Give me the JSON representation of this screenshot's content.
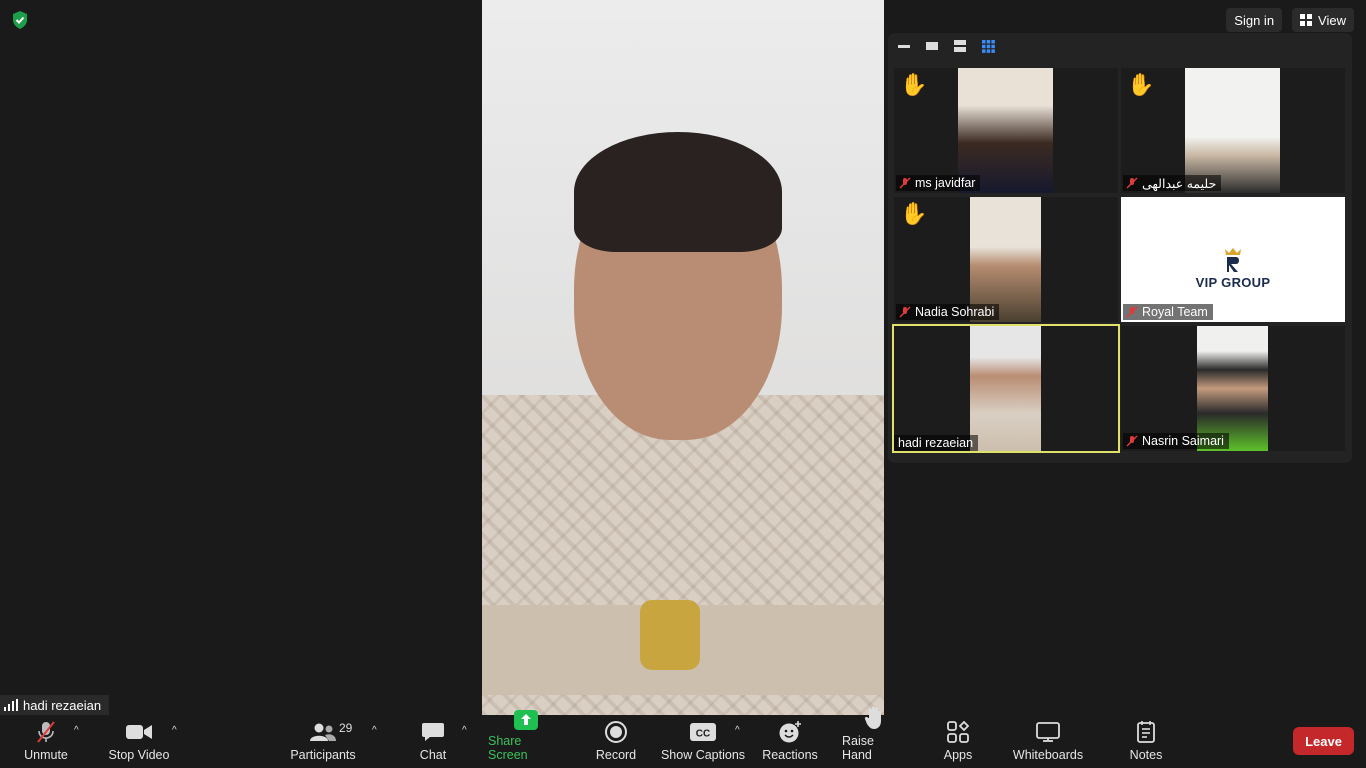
{
  "top": {
    "sign_in": "Sign in",
    "view": "View"
  },
  "main_speaker": {
    "name": "hadi rezaeian"
  },
  "gallery": {
    "tiles": [
      {
        "name": "ms javidfar",
        "muted": true,
        "hand_raised": true
      },
      {
        "name": "حلیمه عبدالهی",
        "muted": true,
        "hand_raised": true
      },
      {
        "name": "Nadia Sohrabi",
        "muted": true,
        "hand_raised": true
      },
      {
        "name": "Royal Team",
        "muted": true,
        "hand_raised": false,
        "logo_text": "VIP GROUP"
      },
      {
        "name": "hadi rezaeian",
        "muted": false,
        "hand_raised": false,
        "active_speaker": true
      },
      {
        "name": "Nasrin Saimari",
        "muted": true,
        "hand_raised": false
      }
    ]
  },
  "toolbar": {
    "unmute": "Unmute",
    "stop_video": "Stop Video",
    "participants": "Participants",
    "participants_count": "29",
    "chat": "Chat",
    "share_screen": "Share Screen",
    "record": "Record",
    "show_captions": "Show Captions",
    "reactions": "Reactions",
    "raise_hand": "Raise Hand",
    "apps": "Apps",
    "whiteboards": "Whiteboards",
    "notes": "Notes",
    "leave": "Leave"
  },
  "colors": {
    "leave": "#c4282a",
    "share": "#3ec15d",
    "active_border": "#e0e06a"
  }
}
